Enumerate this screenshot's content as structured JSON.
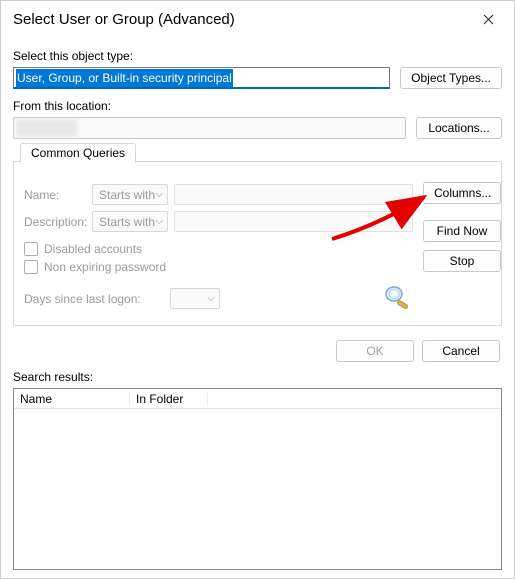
{
  "title": "Select User or Group (Advanced)",
  "object_type": {
    "label": "Select this object type:",
    "value": "User, Group, or Built-in security principal",
    "button": "Object Types..."
  },
  "location": {
    "label": "From this location:",
    "button": "Locations..."
  },
  "queries": {
    "tab": "Common Queries",
    "name_label": "Name:",
    "name_mode": "Starts with",
    "desc_label": "Description:",
    "desc_mode": "Starts with",
    "chk_disabled": "Disabled accounts",
    "chk_nonexp": "Non expiring password",
    "days_label": "Days since last logon:"
  },
  "side_buttons": {
    "columns": "Columns...",
    "find": "Find Now",
    "stop": "Stop"
  },
  "actions": {
    "ok": "OK",
    "cancel": "Cancel"
  },
  "results": {
    "label": "Search results:",
    "col_name": "Name",
    "col_folder": "In Folder"
  }
}
